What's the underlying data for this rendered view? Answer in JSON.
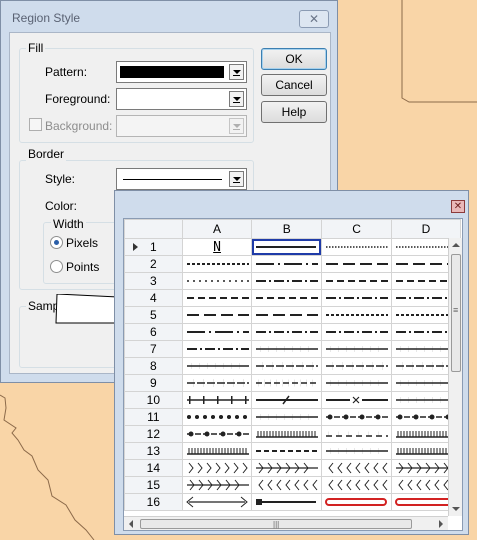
{
  "dialog": {
    "title": "Region Style",
    "close_glyph": "✕",
    "fill": {
      "label": "Fill",
      "pattern_label": "Pattern:",
      "foreground_label": "Foreground:",
      "background_label": "Background:",
      "pattern_color": "#000000"
    },
    "border": {
      "label": "Border",
      "style_label": "Style:",
      "color_label": "Color:",
      "width_label": "Width",
      "pixels_label": "Pixels",
      "points_label": "Points",
      "width_unit_selected": "Pixels"
    },
    "sample_label": "Sample",
    "buttons": {
      "ok": "OK",
      "cancel": "Cancel",
      "help": "Help"
    }
  },
  "palette": {
    "close_glyph": "✕",
    "columns": [
      "A",
      "B",
      "C",
      "D"
    ],
    "rows": [
      "1",
      "2",
      "3",
      "4",
      "5",
      "6",
      "7",
      "8",
      "9",
      "10",
      "11",
      "12",
      "13",
      "14",
      "15",
      "16"
    ],
    "cell_text_A1": "N",
    "selected_cell": "B1",
    "scroll_grip": "|||",
    "vscroll_grip": "≡"
  },
  "colors": {
    "map_fill": "#f9d5a7",
    "map_border": "#8c6a4a",
    "selection_border": "#1f3ba8",
    "red_line": "#d22222"
  }
}
